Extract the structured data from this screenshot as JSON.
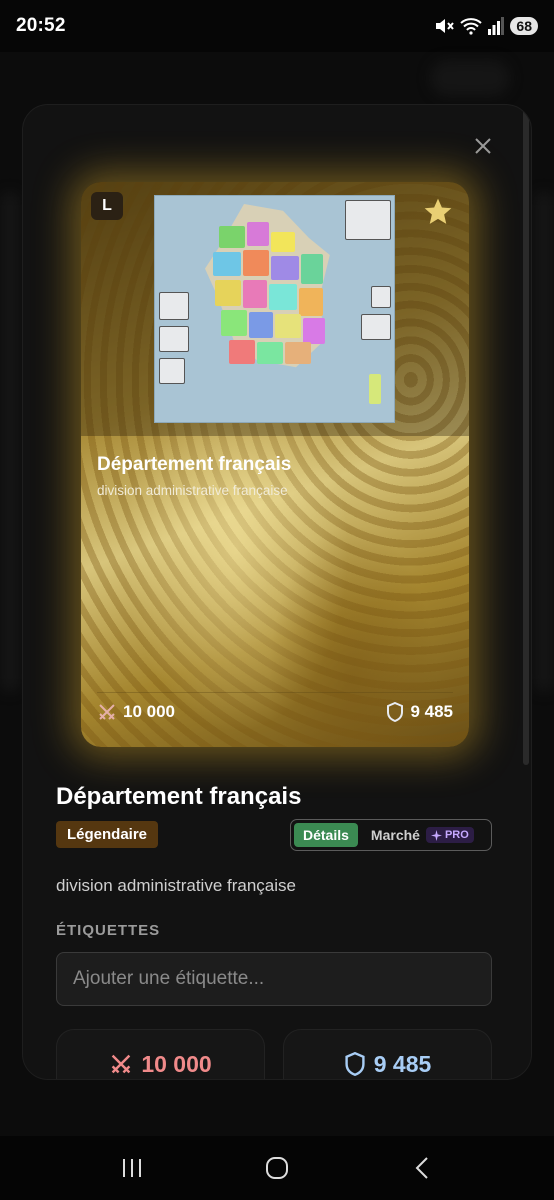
{
  "status_bar": {
    "time": "20:52",
    "battery": "68",
    "icons": [
      "mute-icon",
      "wifi-icon",
      "signal-icon",
      "battery-icon"
    ]
  },
  "card": {
    "rarity_letter": "L",
    "title": "Département français",
    "subtitle": "division administrative française",
    "attack": "10 000",
    "defense": "9 485",
    "accent_color": "#d4a62a"
  },
  "details": {
    "title": "Département français",
    "rarity": "Légendaire",
    "tabs": [
      {
        "label": "Détails",
        "active": true
      },
      {
        "label": "Marché",
        "active": false,
        "badge": "PRO"
      }
    ],
    "description": "division administrative française",
    "tags_label": "ÉTIQUETTES",
    "tag_placeholder": "Ajouter une étiquette...",
    "attack": "10 000",
    "defense": "9 485"
  },
  "colors": {
    "tab_active": "#3b8a52",
    "rarity_pill": "#553710",
    "attack": "#f08a8a",
    "defense": "#a8cdf5"
  }
}
